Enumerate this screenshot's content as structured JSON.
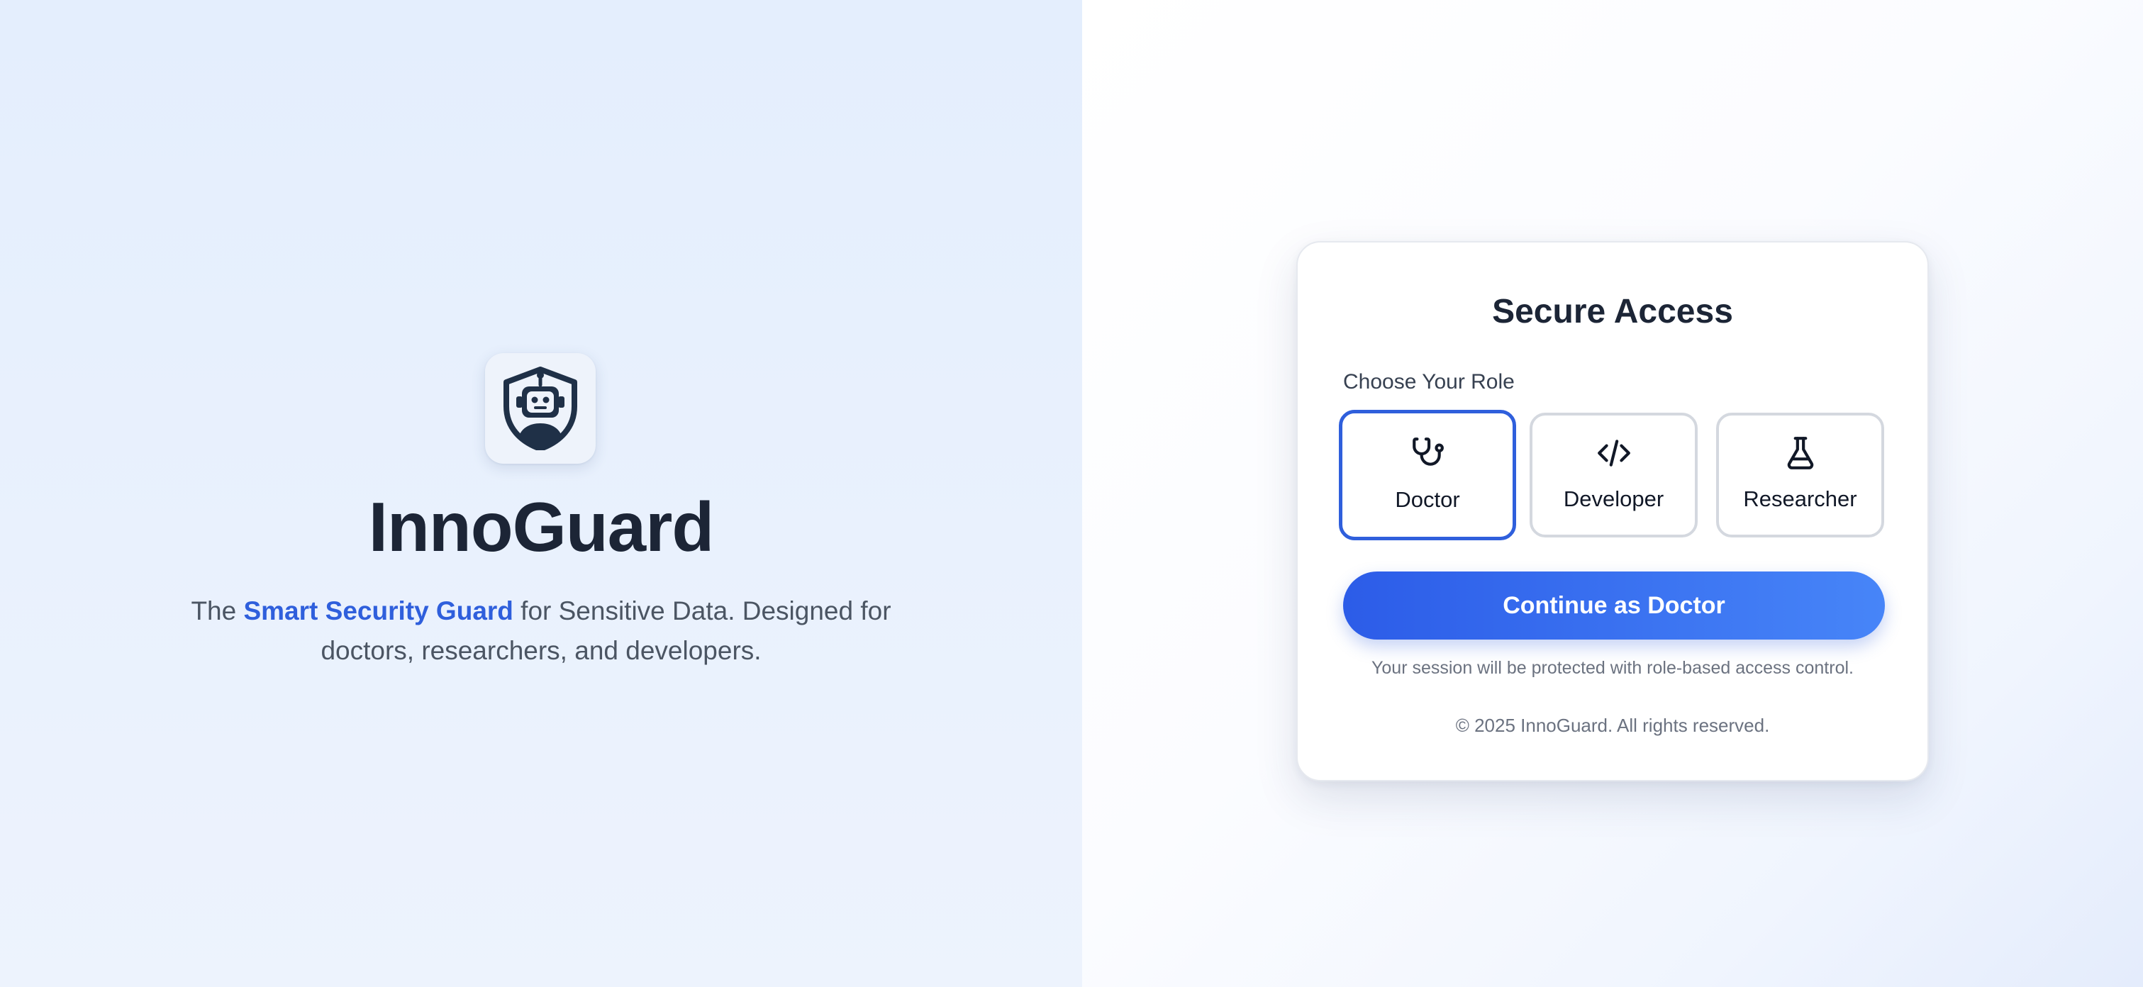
{
  "brand": {
    "name": "InnoGuard",
    "logo_icon": "robot-shield-icon",
    "tagline_prefix": "The ",
    "tagline_highlight": "Smart Security Guard",
    "tagline_suffix": " for Sensitive Data. Designed for doctors, researchers, and developers."
  },
  "login_card": {
    "title": "Secure Access",
    "role_label": "Choose Your Role",
    "roles": [
      {
        "label": "Doctor",
        "icon": "stethoscope-icon",
        "selected": true
      },
      {
        "label": "Developer",
        "icon": "code-icon",
        "selected": false
      },
      {
        "label": "Researcher",
        "icon": "flask-icon",
        "selected": false
      }
    ],
    "continue_label": "Continue as Doctor",
    "session_note": "Your session will be protected with role-based access control.",
    "copyright": "© 2025 InnoGuard. All rights reserved."
  },
  "colors": {
    "accent": "#2f5fdc",
    "button_gradient_start": "#2c5ce8",
    "button_gradient_end": "#4785f8",
    "heading": "#1c2536",
    "muted_text": "#6b7280"
  }
}
